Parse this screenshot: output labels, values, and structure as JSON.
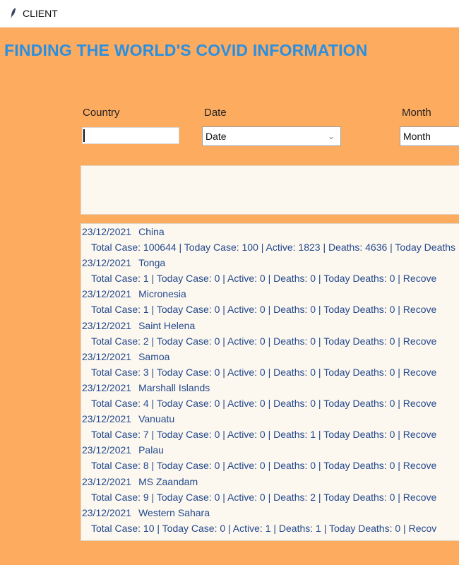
{
  "window": {
    "title": "CLIENT",
    "icon": "feather-icon"
  },
  "heading": "FINDING THE WORLD'S COVID INFORMATION",
  "filters": {
    "country_label": "Country",
    "country_value": "",
    "date_label": "Date",
    "date_value": "Date",
    "month_label": "Month",
    "month_value": "Month"
  },
  "records": [
    {
      "date": "23/12/2021",
      "country": "China",
      "stats": "Total Case: 100644  |  Today Case: 100  |  Active: 1823  |  Deaths: 4636  |  Today Deaths"
    },
    {
      "date": "23/12/2021",
      "country": "Tonga",
      "stats": "Total Case: 1  |  Today Case: 0  |  Active: 0  |  Deaths: 0  |  Today Deaths: 0  |  Recove"
    },
    {
      "date": "23/12/2021",
      "country": "Micronesia",
      "stats": "Total Case: 1  |  Today Case: 0  |  Active: 0  |  Deaths: 0  |  Today Deaths: 0  |  Recove"
    },
    {
      "date": "23/12/2021",
      "country": "Saint Helena",
      "stats": "Total Case: 2  |  Today Case: 0  |  Active: 0  |  Deaths: 0  |  Today Deaths: 0  |  Recove"
    },
    {
      "date": "23/12/2021",
      "country": "Samoa",
      "stats": "Total Case: 3  |  Today Case: 0  |  Active: 0  |  Deaths: 0  |  Today Deaths: 0  |  Recove"
    },
    {
      "date": "23/12/2021",
      "country": "Marshall Islands",
      "stats": "Total Case: 4  |  Today Case: 0  |  Active: 0  |  Deaths: 0  |  Today Deaths: 0  |  Recove"
    },
    {
      "date": "23/12/2021",
      "country": "Vanuatu",
      "stats": "Total Case: 7  |  Today Case: 0  |  Active: 0  |  Deaths: 1  |  Today Deaths: 0  |  Recove"
    },
    {
      "date": "23/12/2021",
      "country": "Palau",
      "stats": "Total Case: 8  |  Today Case: 0  |  Active: 0  |  Deaths: 0  |  Today Deaths: 0  |  Recove"
    },
    {
      "date": "23/12/2021",
      "country": "MS Zaandam",
      "stats": "Total Case: 9  |  Today Case: 0  |  Active: 0  |  Deaths: 2  |  Today Deaths: 0  |  Recove"
    },
    {
      "date": "23/12/2021",
      "country": "Western Sahara",
      "stats": "Total Case: 10  |  Today Case: 0  |  Active: 1  |  Deaths: 1  |  Today Deaths: 0  |  Recov"
    }
  ]
}
